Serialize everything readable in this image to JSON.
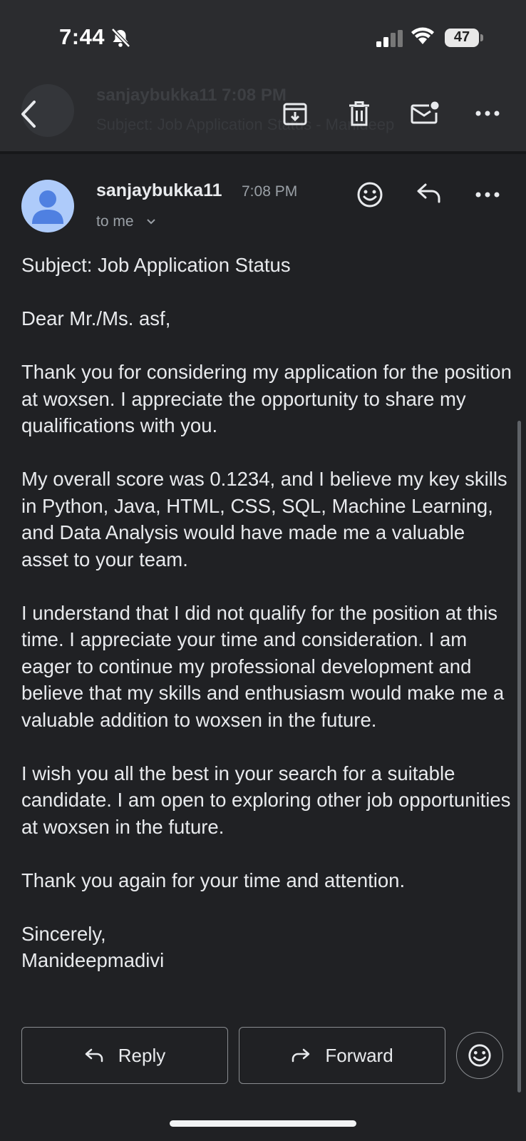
{
  "status_bar": {
    "time": "7:44",
    "battery": "47"
  },
  "header_ghost": {
    "sender": "sanjaybukka11 7:08 PM",
    "subject": "Subject: Job Application Status - Manideep"
  },
  "toolbar": {
    "icons": [
      "back-arrow-icon",
      "archive-icon",
      "trash-icon",
      "mark-unread-icon",
      "more-icon"
    ]
  },
  "message": {
    "sender": "sanjaybukka11",
    "time": "7:08 PM",
    "recipient": "to me",
    "body": {
      "subject_line": "Subject: Job Application Status",
      "greeting": "Dear Mr./Ms. asf,",
      "para1": "Thank you for considering my application for the position at woxsen. I appreciate the opportunity to share my qualifications with you.",
      "para2": "My overall score was 0.1234, and I believe my key skills in Python, Java, HTML, CSS, SQL, Machine Learning, and Data Analysis would have made me a valuable asset to your team.",
      "para3": "I understand that I did not qualify for the position at this time. I appreciate your time and consideration. I am eager to continue my professional development and believe that my skills and enthusiasm would make me a valuable addition to woxsen in the future.",
      "para4": "I wish you all the best in your search for a suitable candidate. I am open to exploring other job opportunities at woxsen in the future.",
      "para5": "Thank you again for your time and attention.",
      "closing": "Sincerely,",
      "signature": "Manideepmadivi"
    }
  },
  "actions": {
    "reply_label": "Reply",
    "forward_label": "Forward"
  },
  "colors": {
    "background": "#202124",
    "topbar": "#2b2c2f",
    "avatar": "#aecbfa",
    "avatar_figure": "#4f80e1"
  }
}
